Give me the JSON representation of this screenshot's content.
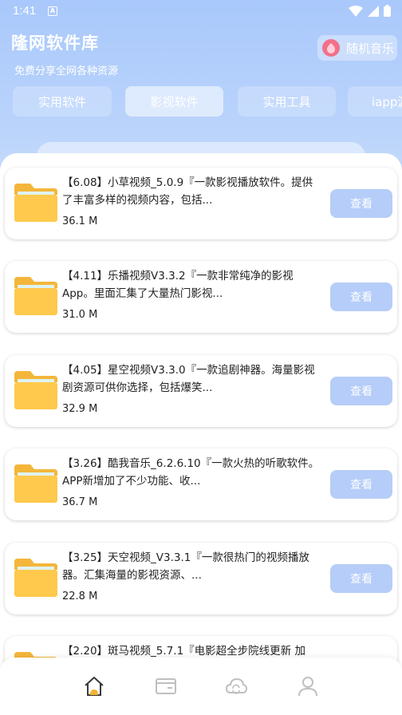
{
  "status_bar": {
    "time": "1:41",
    "badge": "A"
  },
  "header": {
    "title": "隆网软件库",
    "subtitle": "免费分享全网各种资源",
    "music_label": "随机音乐"
  },
  "tabs": [
    {
      "label": "实用软件",
      "active": false
    },
    {
      "label": "影视软件",
      "active": true
    },
    {
      "label": "实用工具",
      "active": false
    },
    {
      "label": "iapp源",
      "active": false
    }
  ],
  "view_label": "查看",
  "items": [
    {
      "title": "【6.08】小草视频_5.0.9『一款影视播放软件。提供了丰富多样的视频内容，包括...",
      "size": "36.1 M"
    },
    {
      "title": "【4.11】乐播视频V3.3.2『一款非常纯净的影视App。里面汇集了大量热门影视...",
      "size": "31.0 M"
    },
    {
      "title": "【4.05】星空视频V3.3.0『一款追剧神器。海量影视剧资源可供你选择，包括爆笑...",
      "size": "32.9 M"
    },
    {
      "title": "【3.26】酷我音乐_6.2.6.10『一款火热的听歌软件。APP新增加了不少功能、收...",
      "size": "36.7 M"
    },
    {
      "title": "【3.25】天空视频_V3.3.1『一款很热门的视频播放器。汇集海量的影视资源、...",
      "size": "22.8 M"
    },
    {
      "title": "【2.20】斑马视频_5.7.1『电影超全步院线更新 加",
      "size": ""
    }
  ],
  "bottom_nav": [
    {
      "icon": "home-icon",
      "active": true
    },
    {
      "icon": "folder-icon",
      "active": false
    },
    {
      "icon": "cloud-sync-icon",
      "active": false
    },
    {
      "icon": "profile-icon",
      "active": false
    }
  ],
  "colors": {
    "header": "#a9c8fb",
    "button": "#b5cdf8",
    "accent": "#f2708a",
    "folder": "#ffc94d"
  }
}
